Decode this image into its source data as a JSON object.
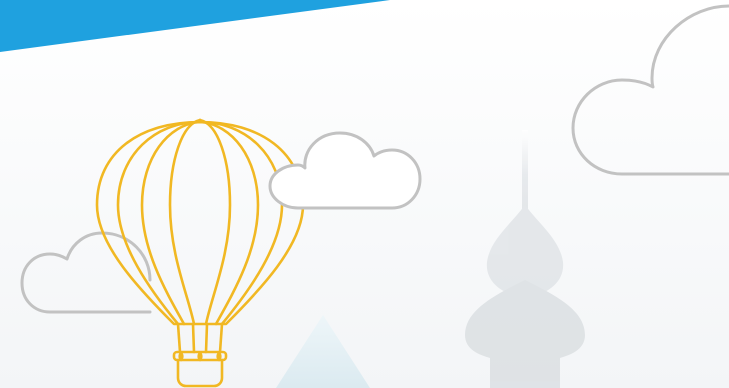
{
  "scene": {
    "banner_color": "#1FA1DF",
    "outline_color": "#C2C2C2",
    "balloon_color": "#F1B823",
    "silhouette_color": "#D6DBDE",
    "silhouette_light_color": "#CFE6EE",
    "icons": [
      "top-banner",
      "hot-air-balloon-icon",
      "cloud-icon",
      "tower-silhouette",
      "spire-silhouette"
    ]
  }
}
